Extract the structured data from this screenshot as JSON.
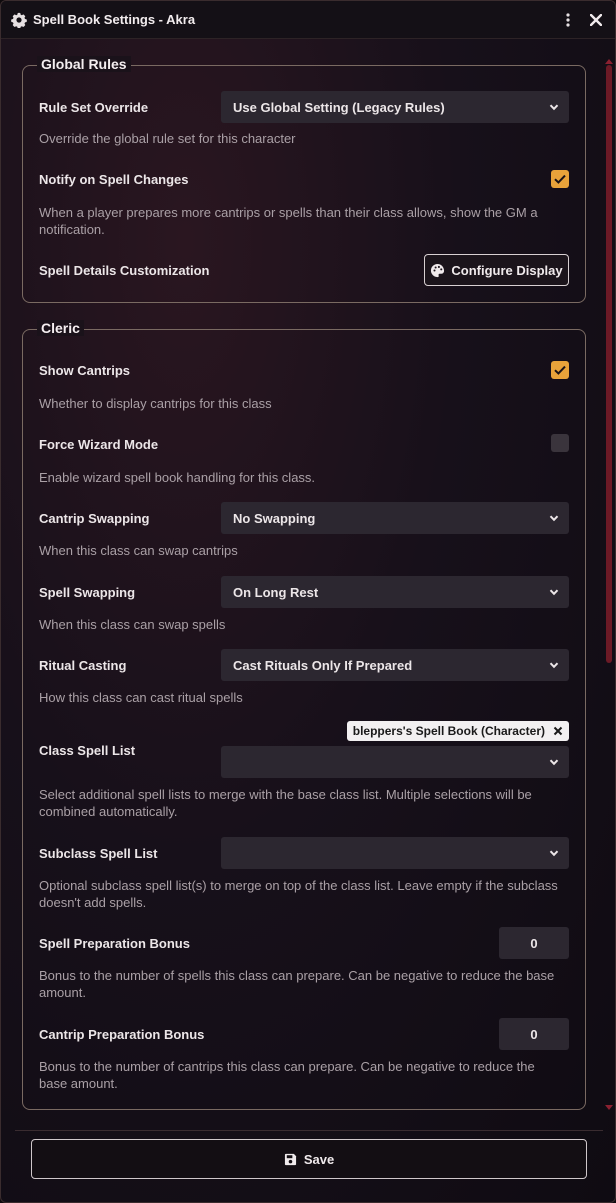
{
  "window": {
    "title": "Spell Book Settings - Akra"
  },
  "global_rules": {
    "legend": "Global Rules",
    "rule_set": {
      "label": "Rule Set Override",
      "value": "Use Global Setting (Legacy Rules)",
      "hint": "Override the global rule set for this character"
    },
    "notify": {
      "label": "Notify on Spell Changes",
      "checked": true,
      "hint": "When a player prepares more cantrips or spells than their class allows, show the GM a notification."
    },
    "details": {
      "label": "Spell Details Customization",
      "button": "Configure Display"
    }
  },
  "cleric": {
    "legend": "Cleric",
    "show_cantrips": {
      "label": "Show Cantrips",
      "checked": true,
      "hint": "Whether to display cantrips for this class"
    },
    "force_wizard": {
      "label": "Force Wizard Mode",
      "checked": false,
      "hint": "Enable wizard spell book handling for this class."
    },
    "cantrip_swapping": {
      "label": "Cantrip Swapping",
      "value": "No Swapping",
      "hint": "When this class can swap cantrips"
    },
    "spell_swapping": {
      "label": "Spell Swapping",
      "value": "On Long Rest",
      "hint": "When this class can swap spells"
    },
    "ritual_casting": {
      "label": "Ritual Casting",
      "value": "Cast Rituals Only If Prepared",
      "hint": "How this class can cast ritual spells"
    },
    "class_spell_list": {
      "label": "Class Spell List",
      "tag": "bleppers's Spell Book (Character)",
      "value": "",
      "hint": "Select additional spell lists to merge with the base class list. Multiple selections will be combined automatically."
    },
    "subclass_spell_list": {
      "label": "Subclass Spell List",
      "value": "",
      "hint": "Optional subclass spell list(s) to merge on top of the class list. Leave empty if the subclass doesn't add spells."
    },
    "spell_bonus": {
      "label": "Spell Preparation Bonus",
      "value": "0",
      "hint": "Bonus to the number of spells this class can prepare. Can be negative to reduce the base amount."
    },
    "cantrip_bonus": {
      "label": "Cantrip Preparation Bonus",
      "value": "0",
      "hint": "Bonus to the number of cantrips this class can prepare. Can be negative to reduce the base amount."
    }
  },
  "footer": {
    "save": "Save"
  },
  "colors": {
    "accent": "#e8a23a",
    "scrollbar": "#6c1a26"
  }
}
